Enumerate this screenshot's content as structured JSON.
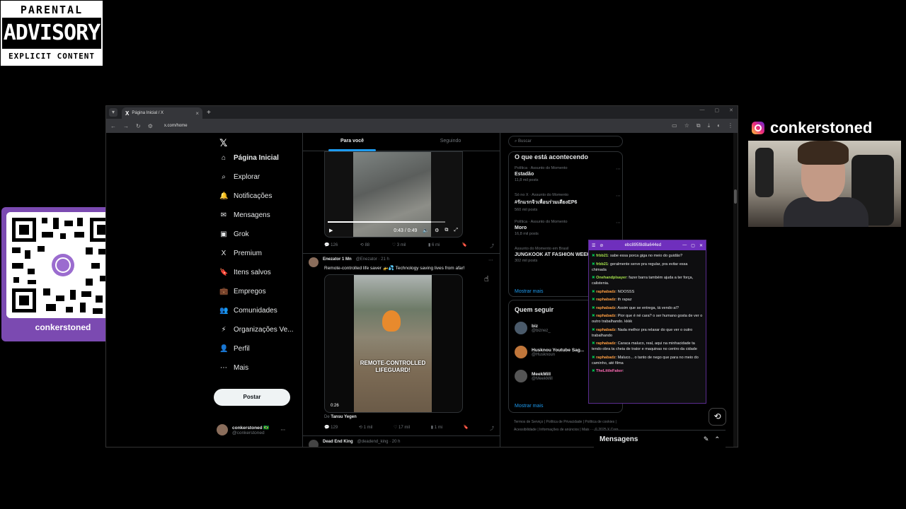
{
  "advisory": {
    "line1": "PARENTAL",
    "line2": "ADVISORY",
    "line3": "EXPLICIT CONTENT"
  },
  "qr": {
    "name": "conkerstoned"
  },
  "instagram": {
    "icon": "instagram-icon",
    "handle": "conkerstoned"
  },
  "browser": {
    "tab_title": "Página Inicial / X",
    "url": "x.com/home",
    "colors": {
      "tabbar": "#202124",
      "toolbar": "#35363a"
    }
  },
  "nav": {
    "items": [
      {
        "icon": "⌂",
        "label": "Página Inicial"
      },
      {
        "icon": "⌕",
        "label": "Explorar"
      },
      {
        "icon": "🔔",
        "label": "Notificações"
      },
      {
        "icon": "✉",
        "label": "Mensagens"
      },
      {
        "icon": "▣",
        "label": "Grok"
      },
      {
        "icon": "X",
        "label": "Premium"
      },
      {
        "icon": "🔖",
        "label": "Itens salvos"
      },
      {
        "icon": "💼",
        "label": "Empregos"
      },
      {
        "icon": "👥",
        "label": "Comunidades"
      },
      {
        "icon": "⚡",
        "label": "Organizações Ve..."
      },
      {
        "icon": "👤",
        "label": "Perfil"
      },
      {
        "icon": "⋯",
        "label": "Mais"
      }
    ],
    "post_label": "Postar",
    "profile_name": "conkerstoned 🇧🇷",
    "profile_handle": "@conkerstoned"
  },
  "feed": {
    "tabs": [
      "Para você",
      "Seguindo"
    ],
    "video1": {
      "time": "0:43 / 0:49",
      "progress": 0.88
    },
    "actions1": {
      "replies": "126",
      "reposts": "88",
      "likes": "3 mil",
      "views": "6 mi"
    },
    "tweet2": {
      "name": "Enezator 1 Mn",
      "handle": "@Enezator · 21 h",
      "text": "Remote-controlled life saver 🚁💦 Technology saving lives from afar!",
      "caption": "REMOTE-CONTROLLED LIFEGUARD!",
      "duration": "0:26",
      "from_label": "De",
      "from_user": "Tansu Yegen"
    },
    "actions2": {
      "replies": "129",
      "reposts": "1 mil",
      "likes": "17 mil",
      "views": "1 mi"
    },
    "tweet3": {
      "name": "Dead End King",
      "handle": "@deadend_king · 20 h"
    }
  },
  "right": {
    "search_placeholder": "Buscar",
    "trends_title": "O que está acontecendo",
    "trends": [
      {
        "meta": "Política · Assunto do Momento",
        "name": "Estadão",
        "count": "11,8 mil posts"
      },
      {
        "meta": "Só no X · Assunto do Momento",
        "name": "#รักแรกจิวเพื่อนร่วมเตียงEP6",
        "count": "560 mil posts"
      },
      {
        "meta": "Política · Assunto do Momento",
        "name": "Moro",
        "count": "16,8 mil posts"
      },
      {
        "meta": "Assunto do Momento em Brasil",
        "name": "JUNGKOOK AT FASHION WEEK",
        "count": "302 mil posts"
      }
    ],
    "show_more": "Mostrar mais",
    "follow_title": "Quem seguir",
    "follow": [
      {
        "name": "biz",
        "handle": "@biznez_",
        "color": "#4a5a6a"
      },
      {
        "name": "Husknou Youtube Sag...",
        "handle": "@Husknoun",
        "color": "#c0763a"
      },
      {
        "name": "MeekMill",
        "handle": "@MeekMill",
        "color": "#555"
      }
    ],
    "footer": "Termos de Serviço | Política de Privacidade | Política de cookies | Acessibilidade | Informações de anúncios | Mais ··· © 2025 X Corp."
  },
  "chat": {
    "title": "ebc895f8d8a644ed",
    "messages": [
      {
        "user": "frbb21",
        "cls": "u-green",
        "text": ": sabe essa porca giga no meio do guidão?"
      },
      {
        "user": "frbb21",
        "cls": "u-green",
        "text": ": geralmente serve pra regular, pra evitar essa chimada"
      },
      {
        "user": "Onehandplsayer",
        "cls": "u-green",
        "text": ": fazer barra também ajuda a ter força, calistenia."
      },
      {
        "user": "raphabadz",
        "cls": "u-orange",
        "text": ": NOOSSS"
      },
      {
        "user": "raphabadz",
        "cls": "u-orange",
        "text": ": th rapaz"
      },
      {
        "user": "raphabadz",
        "cls": "u-orange",
        "text": ": Assim que se entrega, tá vendo aí?"
      },
      {
        "user": "raphabadz",
        "cls": "u-orange",
        "text": ": Pior que é né cara? o ser humano gosta de ver o outro trabalhando. kkkk"
      },
      {
        "user": "raphabadz",
        "cls": "u-orange",
        "text": ": Nada melhor pra relaxar do que ver o outro trabalhando"
      },
      {
        "user": "raphabadz",
        "cls": "u-orange",
        "text": ": Caraca maluco, real, aqui na minhacidade ta tendo obra ta cheia de trator e maquinas no centro da cidade"
      },
      {
        "user": "raphabadz",
        "cls": "u-orange",
        "text": ": Maluco... o tanto de nego que para no meio do caminho, até filma"
      },
      {
        "user": "TheLittleFaker",
        "cls": "u-pink",
        "text": ":"
      }
    ]
  },
  "messages_bar": {
    "label": "Mensagens"
  }
}
